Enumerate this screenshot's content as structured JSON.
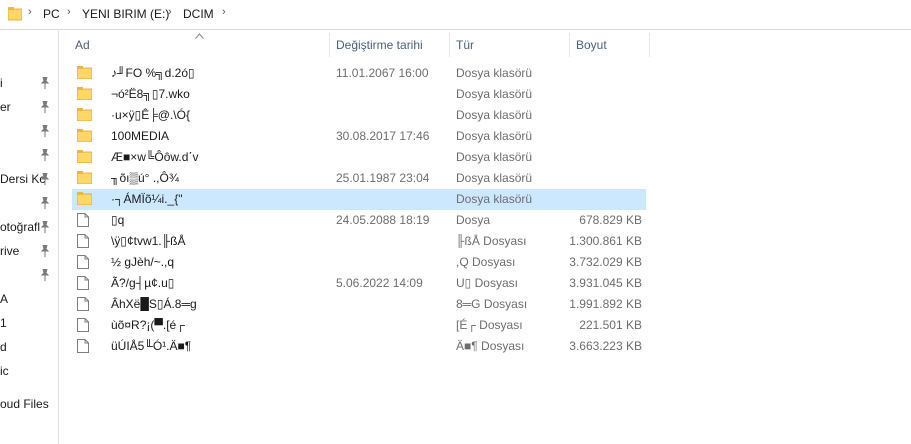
{
  "breadcrumb": [
    "PC",
    "YENI BIRIM (E:)",
    "DCIM"
  ],
  "columns": {
    "name": "Ad",
    "date": "Değiştirme tarihi",
    "type": "Tür",
    "size": "Boyut"
  },
  "nav_items": [
    "i",
    "er",
    "",
    "",
    "Dersi Kc",
    "",
    "otoğrafl",
    "rive",
    "",
    "A",
    "1",
    "d",
    "ic",
    "oud Files"
  ],
  "rows": [
    {
      "name": "♪╜FO %╗d.2ó▯",
      "date": "11.01.2067 16:00",
      "type": "Dosya klasörü",
      "size": "",
      "kind": "folder"
    },
    {
      "name": "¬ó²Ë8╗▯7.wko",
      "date": "",
      "type": "Dosya klasörü",
      "size": "",
      "kind": "folder"
    },
    {
      "name": "·u×ÿ▯Ê╞@.\\Ó{",
      "date": "",
      "type": "Dosya klasörü",
      "size": "",
      "kind": "folder"
    },
    {
      "name": "100MEDIA",
      "date": "30.08.2017 17:46",
      "type": "Dosya klasörü",
      "size": "",
      "kind": "folder"
    },
    {
      "name": "Æ■×w╚Ôôw.d΄v",
      "date": "",
      "type": "Dosya klasörü",
      "size": "",
      "kind": "folder"
    },
    {
      "name": "╖õı▒ú° .,Ô¾",
      "date": "25.01.1987 23:04",
      "type": "Dosya klasörü",
      "size": "",
      "kind": "folder"
    },
    {
      "name": "·┐ÁMÏõ¼i._{\"",
      "date": "",
      "type": "Dosya klasörü",
      "size": "",
      "kind": "folder",
      "selected": true
    },
    {
      "name": " ▯q",
      "date": "24.05.2088 18:19",
      "type": "Dosya",
      "size": "678.829 KB",
      "kind": "file"
    },
    {
      "name": "\\ÿ▯¢tvw1.╟ßÅ",
      "date": "",
      "type": "╟ßÅ Dosyası",
      "size": "1.300.861 KB",
      "kind": "file"
    },
    {
      "name": "½ gJèh/~.,q",
      "date": "",
      "type": ",Q Dosyası",
      "size": "3.732.029 KB",
      "kind": "file"
    },
    {
      "name": "Ã?/g┤µ¢.u▯",
      "date": "5.06.2022 14:09",
      "type": "U▯ Dosyası",
      "size": "3.931.045 KB",
      "kind": "file"
    },
    {
      "name": "ÂhXë█S▯Á.8═g",
      "date": "",
      "type": "8═G Dosyası",
      "size": "1.991.892 KB",
      "kind": "file"
    },
    {
      "name": "ùõ¤R?¡(▀.[é┌",
      "date": "",
      "type": "[É┌ Dosyası",
      "size": "221.501 KB",
      "kind": "file"
    },
    {
      "name": "üÚIÅ5╙Ó¹.Ä■¶",
      "date": "",
      "type": "Ä■¶ Dosyası",
      "size": "3.663.223 KB",
      "kind": "file"
    }
  ],
  "colors": {
    "folder": "#ffd767",
    "folder_tab": "#e8b93c",
    "selected": "#cce8ff",
    "header_text": "#4c607a"
  }
}
